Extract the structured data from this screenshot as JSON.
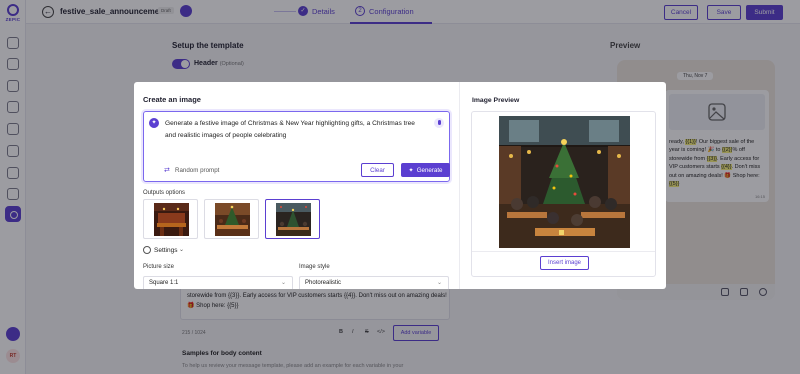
{
  "app": {
    "logo_text": "ZEPIC"
  },
  "topbar": {
    "template_name": "festive_sale_announcement",
    "status_badge": "Draft",
    "steps": [
      {
        "number": "✓",
        "label": "Details"
      },
      {
        "number": "2",
        "label": "Configuration"
      }
    ],
    "cancel_label": "Cancel",
    "save_label": "Save",
    "submit_label": "Submit"
  },
  "sidebar": {
    "avatar_initials": "RT"
  },
  "setup": {
    "title": "Setup the template",
    "header_label": "Header",
    "header_optional": "(Optional)"
  },
  "preview": {
    "title": "Preview",
    "date": "Thu, Nov 7",
    "message_parts": [
      {
        "text": "ready, ",
        "hl": false
      },
      {
        "text": "{{1}}",
        "hl": true
      },
      {
        "text": "! Our biggest sale of the year is coming! 🎉 ",
        "hl": false
      },
      {
        "text": "to ",
        "hl": false
      },
      {
        "text": "{{2}}",
        "hl": true
      },
      {
        "text": "% off storewide from ",
        "hl": false
      },
      {
        "text": "{{3}}",
        "hl": true
      },
      {
        "text": ". Early access for VIP customers starts ",
        "hl": false
      },
      {
        "text": "{{4}}",
        "hl": true
      },
      {
        "text": ". Don't miss out on amazing deals! 🎁 Shop here: ",
        "hl": false
      },
      {
        "text": "{{5}}",
        "hl": true
      }
    ],
    "time": "16:15"
  },
  "body": {
    "text": "storewide from {{3}}. Early access for VIP customers starts {{4}}. Don't miss out on amazing deals! 🎁 Shop here: {{5}}",
    "char_count": "215 / 1024",
    "format_bold": "B",
    "format_italic": "I",
    "format_strike": "S",
    "format_code": "</>",
    "add_variable_label": "Add variable",
    "samples_title": "Samples for body content",
    "samples_desc": "To help us review your message template, please add an example for each variable in your"
  },
  "modal": {
    "title": "Create an image",
    "prompt": "Generate a festive image of Christmas & New Year highlighting gifts, a Christmas tree and realistic images of people celebrating",
    "random_prompt_label": "Random prompt",
    "clear_label": "Clear",
    "generate_label": "Generate",
    "outputs_label": "Outputs options",
    "settings_label": "Settings",
    "picture_size_label": "Picture size",
    "picture_size_value": "Square 1:1",
    "image_style_label": "Image style",
    "image_style_value": "Photorealistic",
    "image_preview_title": "Image Preview",
    "insert_label": "Insert image"
  },
  "colors": {
    "accent": "#5b3fd1",
    "highlight": "#f6f07a"
  },
  "icons": [
    "back-arrow-icon",
    "ai-sparkle-icon",
    "mic-icon",
    "shuffle-icon",
    "gear-icon",
    "chevron-down-icon",
    "image-icon",
    "emoji-icon",
    "camera-icon",
    "microphone-icon"
  ]
}
